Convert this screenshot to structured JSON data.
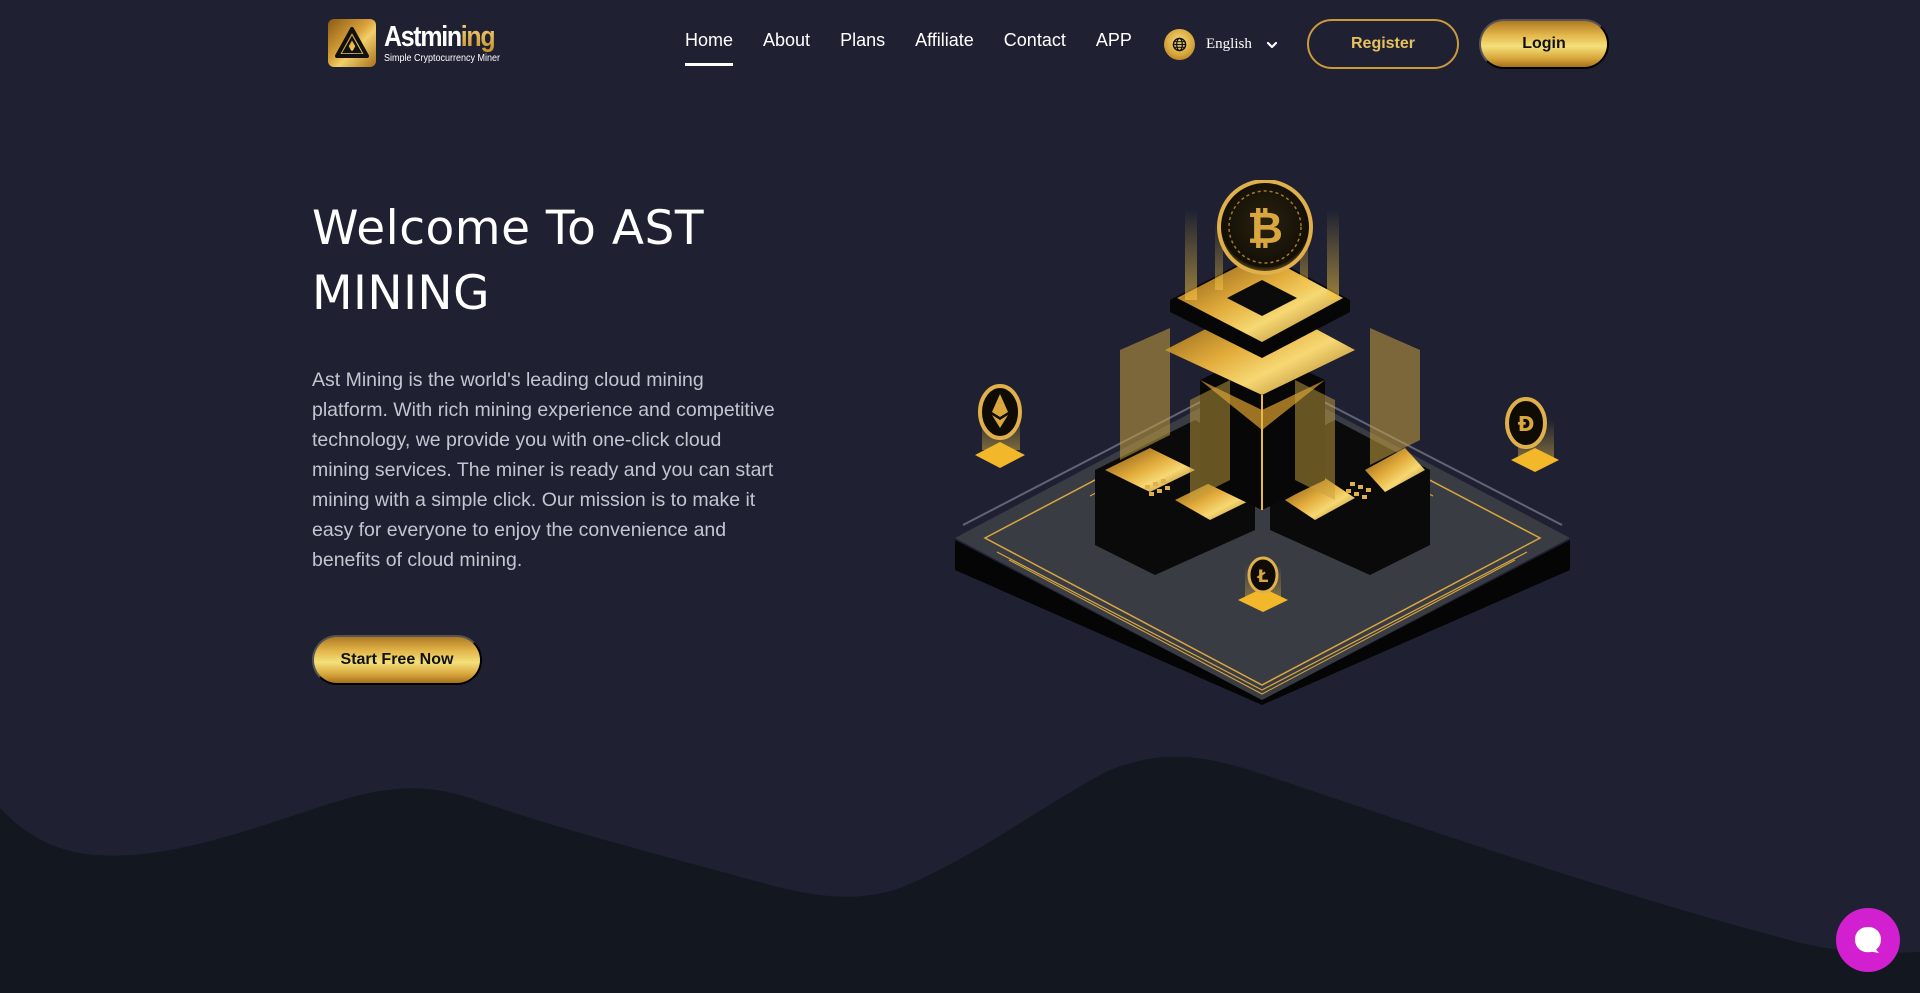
{
  "header": {
    "logo": {
      "word_main": "Astmin",
      "word_accent": "ing",
      "tagline": "Simple Cryptocurrency Miner"
    },
    "nav": [
      {
        "label": "Home",
        "active": true
      },
      {
        "label": "About",
        "active": false
      },
      {
        "label": "Plans",
        "active": false
      },
      {
        "label": "Affiliate",
        "active": false
      },
      {
        "label": "Contact",
        "active": false
      },
      {
        "label": "APP",
        "active": false
      }
    ],
    "language": {
      "icon": "globe-icon",
      "selected": "English"
    },
    "register_label": "Register",
    "login_label": "Login"
  },
  "hero": {
    "title": "Welcome To AST MINING",
    "description": "Ast Mining is the world's leading cloud mining platform. With rich mining experience and competitive technology, we provide you with one-click cloud mining services. The miner is ready and you can start mining with a simple click. Our mission is to make it easy for everyone to enjoy the convenience and benefits of cloud mining.",
    "cta_label": "Start Free Now",
    "illustration": {
      "subject": "isometric crypto mining platform",
      "coins": [
        "bitcoin",
        "ethereum",
        "dash",
        "litecoin"
      ]
    }
  },
  "chat": {
    "icon": "chat-bubble-icon"
  },
  "colors": {
    "background": "#1f2133",
    "background_dark": "#131720",
    "gold": "#e2b54a",
    "chat": "#d21fcf"
  }
}
